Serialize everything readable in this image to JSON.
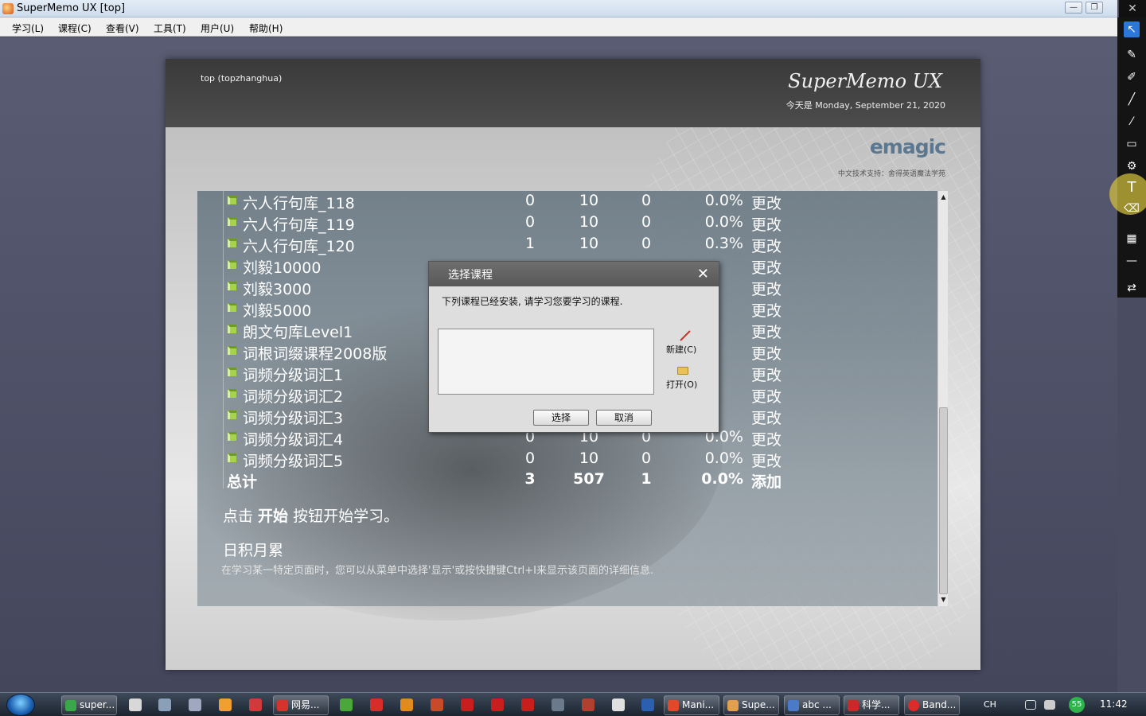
{
  "window": {
    "title": "SuperMemo UX [top]",
    "min_glyph": "—",
    "max_glyph": "❐",
    "close_glyph": "✕"
  },
  "menu": [
    "学习(L)",
    "课程(C)",
    "查看(V)",
    "工具(T)",
    "用户(U)",
    "帮助(H)"
  ],
  "header": {
    "user": "top (topzhanghua)",
    "brand": "SuperMemo UX",
    "date": "今天是 Monday, September 21, 2020",
    "logo": "emagic",
    "support": "中文技术支持：舍得英语魔法学苑"
  },
  "courses": [
    {
      "name": "六人行句库_118",
      "c1": "0",
      "c2": "10",
      "c3": "0",
      "c4": "0.0%",
      "action": "更改"
    },
    {
      "name": "六人行句库_119",
      "c1": "0",
      "c2": "10",
      "c3": "0",
      "c4": "0.0%",
      "action": "更改"
    },
    {
      "name": "六人行句库_120",
      "c1": "1",
      "c2": "10",
      "c3": "0",
      "c4": "0.3%",
      "action": "更改"
    },
    {
      "name": "刘毅10000",
      "c1": "",
      "c2": "",
      "c3": "",
      "c4": "",
      "action": "更改"
    },
    {
      "name": "刘毅3000",
      "c1": "",
      "c2": "",
      "c3": "",
      "c4": "",
      "action": "更改"
    },
    {
      "name": "刘毅5000",
      "c1": "",
      "c2": "",
      "c3": "",
      "c4": "",
      "action": "更改"
    },
    {
      "name": "朗文句库Level1",
      "c1": "",
      "c2": "",
      "c3": "",
      "c4": "",
      "action": "更改"
    },
    {
      "name": "词根词缀课程2008版",
      "c1": "",
      "c2": "",
      "c3": "",
      "c4": "",
      "action": "更改"
    },
    {
      "name": "词频分级词汇1",
      "c1": "",
      "c2": "",
      "c3": "",
      "c4": "",
      "action": "更改"
    },
    {
      "name": "词频分级词汇2",
      "c1": "",
      "c2": "",
      "c3": "",
      "c4": "",
      "action": "更改"
    },
    {
      "name": "词频分级词汇3",
      "c1": "",
      "c2": "",
      "c3": "",
      "c4": "",
      "action": "更改"
    },
    {
      "name": "词频分级词汇4",
      "c1": "0",
      "c2": "10",
      "c3": "0",
      "c4": "0.0%",
      "action": "更改"
    },
    {
      "name": "词频分级词汇5",
      "c1": "0",
      "c2": "10",
      "c3": "0",
      "c4": "0.0%",
      "action": "更改"
    }
  ],
  "total": {
    "name": "总计",
    "c1": "3",
    "c2": "507",
    "c3": "1",
    "c4": "0.0%",
    "action": "添加"
  },
  "start_hint": {
    "pre": "点击 ",
    "bold": "开始",
    "post": " 按钮开始学习。"
  },
  "tip": {
    "title": "日积月累",
    "text": "在学习某一特定页面时，您可以从菜单中选择'显示'或按快捷键Ctrl+I来显示该页面的详细信息."
  },
  "dialog": {
    "title": "选择课程",
    "close": "✕",
    "message": "下列课程已经安装, 请学习您要学习的课程.",
    "new_label": "新建(C)",
    "open_label": "打开(O)",
    "select_button": "选择",
    "cancel_button": "取消"
  },
  "scrollbar": {
    "up": "▲",
    "down": "▼"
  },
  "tools": [
    "pointer-icon",
    "pen-icon",
    "marker-icon",
    "line-icon",
    "brush-icon",
    "rectangle-icon",
    "stamp-icon",
    "text-icon",
    "eraser-icon",
    "checker-icon",
    "dash-icon",
    "swap-icon"
  ],
  "tool_glyphs": {
    "pointer": "↖",
    "pen": "✎",
    "marker": "✐",
    "line": "╱",
    "brush": "⁄",
    "rect": "▭",
    "stamp": "⚙",
    "text": "T",
    "eraser": "⌫",
    "checker": "▦",
    "dash": "—",
    "swap": "⇄"
  },
  "taskbar": {
    "buttons": [
      "super...",
      "网易...",
      "Mani...",
      "Supe...",
      "abc ...",
      "科学...",
      "Band..."
    ],
    "lang": "CH",
    "badge": "55",
    "clock": "11:42"
  }
}
